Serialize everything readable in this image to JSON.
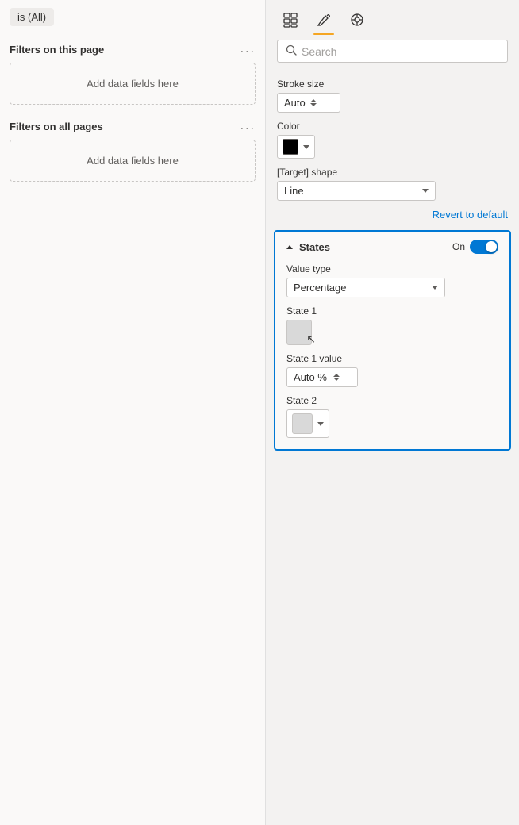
{
  "left": {
    "filter_tag": "is (All)",
    "filters_this_page": {
      "title": "Filters on this page",
      "dots": "...",
      "add_fields": "Add data fields here"
    },
    "filters_all_pages": {
      "title": "Filters on all pages",
      "dots": "...",
      "add_fields": "Add data fields here"
    }
  },
  "right": {
    "toolbar": {
      "icons": [
        "grid-icon",
        "paint-icon",
        "format-icon"
      ]
    },
    "search": {
      "placeholder": "Search"
    },
    "properties": {
      "stroke_size_label": "Stroke size",
      "stroke_size_value": "Auto",
      "color_label": "Color",
      "color_hex": "#000000",
      "target_shape_label": "[Target] shape",
      "target_shape_value": "Line",
      "revert_label": "Revert to default"
    },
    "states": {
      "title": "States",
      "toggle_label": "On",
      "value_type_label": "Value type",
      "value_type_value": "Percentage",
      "state1_label": "State 1",
      "state1_value_label": "State 1 value",
      "state1_value": "Auto %",
      "state2_label": "State 2"
    }
  }
}
